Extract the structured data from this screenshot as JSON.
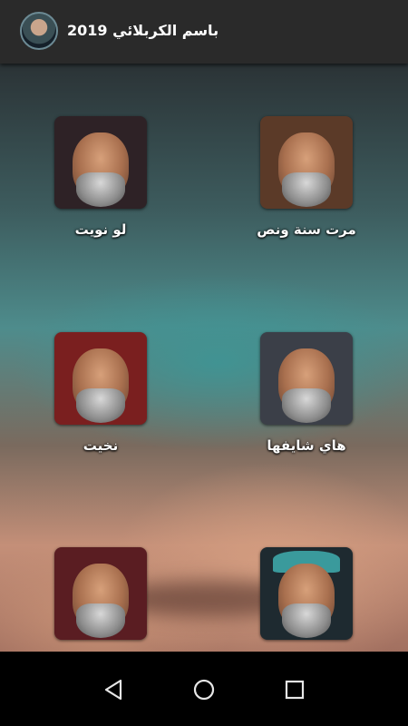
{
  "app": {
    "title": "باسم الكربلائي 2019"
  },
  "tiles": [
    {
      "label": "مرت سنة ونص",
      "tone": "#5b3a28"
    },
    {
      "label": "لو نويت",
      "tone": "#2e2226"
    },
    {
      "label": "هاي شايفها",
      "tone": "#3b3f48"
    },
    {
      "label": "نخيت",
      "tone": "#7a1f1f"
    },
    {
      "label": "",
      "tone": "#1e2a30"
    },
    {
      "label": "",
      "tone": "#5a1d22"
    }
  ],
  "nav": {
    "back": "back-icon",
    "home": "home-icon",
    "recents": "recents-icon"
  }
}
